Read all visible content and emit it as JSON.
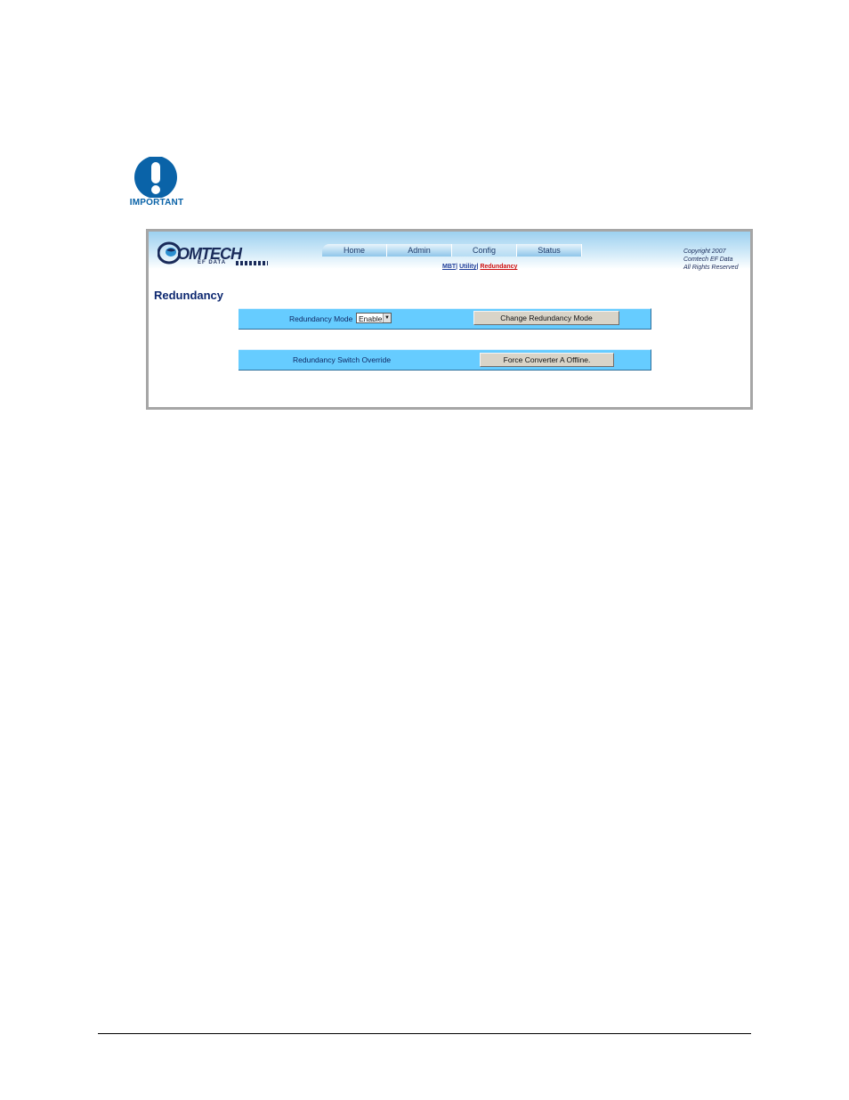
{
  "important_icon": {
    "label": "IMPORTANT",
    "color": "#0a63a8"
  },
  "header": {
    "logo": {
      "text": "OMTECH",
      "subtitle": "EF DATA"
    },
    "nav": [
      {
        "label": "Home"
      },
      {
        "label": "Admin"
      },
      {
        "label": "Config"
      },
      {
        "label": "Status"
      }
    ],
    "subnav": [
      {
        "label": "MBT"
      },
      {
        "label": "Utility"
      },
      {
        "label": "Redundancy"
      }
    ],
    "copyright": [
      "Copyright 2007",
      "Comtech EF Data",
      "All Rights Reserved"
    ]
  },
  "page": {
    "title": "Redundancy",
    "mode_row": {
      "label": "Redundancy Mode",
      "select_value": "Enable",
      "button": "Change Redundancy Mode"
    },
    "override_row": {
      "label": "Redundancy Switch Override",
      "button": "Force Converter A Offline."
    }
  },
  "colors": {
    "row_bg": "#66ccff",
    "title": "#0d2870",
    "active_link": "#cc1111",
    "link": "#1f3f9a"
  }
}
